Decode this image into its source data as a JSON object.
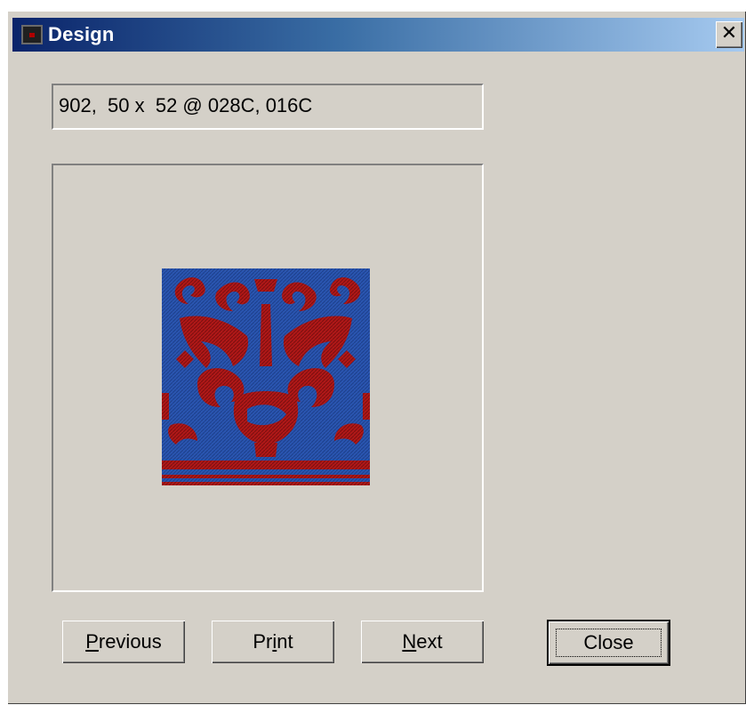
{
  "window": {
    "title": "Design",
    "close_glyph": "✕"
  },
  "info": {
    "text": "902,  50 x  52 @ 028C, 016C"
  },
  "preview": {
    "icon": "design-preview-image",
    "colors": {
      "background": "#2a55b0",
      "pattern": "#b01818"
    }
  },
  "buttons": {
    "previous_first": "P",
    "previous_rest": "revious",
    "print_first": "Pr",
    "print_mnemonic": "i",
    "print_rest": "nt",
    "next_first": "N",
    "next_rest": "ext",
    "close": "Close"
  }
}
